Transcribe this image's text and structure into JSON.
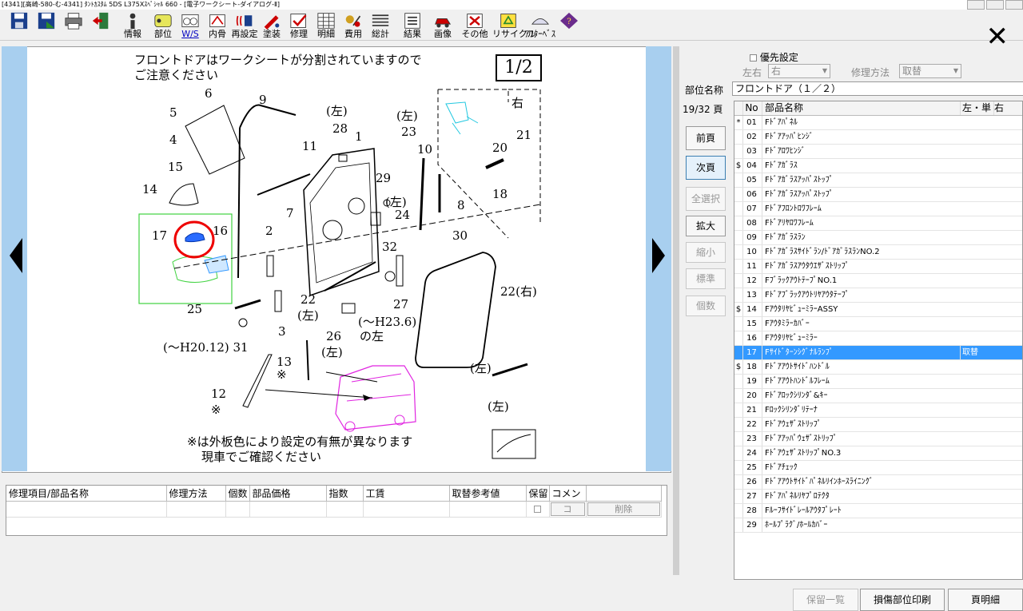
{
  "window": {
    "title": "[4341][高崎-580-む-4341] ﾀﾝﾄｶｽﾀﾑ 5DS L375Xｽﾍﾟｼｬﾙ 660 - [電子ワークシート-ダイアログ-Ⅱ]"
  },
  "toolbar": {
    "items": [
      {
        "label": "",
        "icon": "save-icon"
      },
      {
        "label": "",
        "icon": "save-as-icon"
      },
      {
        "label": "",
        "icon": "print-icon"
      },
      {
        "label": "",
        "icon": "exit-door-icon"
      },
      {
        "label": "情報",
        "icon": "info-icon"
      },
      {
        "label": "部位",
        "icon": "part-icon"
      },
      {
        "label": "W/S",
        "icon": "worksheet-icon"
      },
      {
        "label": "内骨",
        "icon": "inner-frame-icon"
      },
      {
        "label": "再設定",
        "icon": "reset-icon"
      },
      {
        "label": "塗装",
        "icon": "paint-icon"
      },
      {
        "label": "修理",
        "icon": "repair-icon"
      },
      {
        "label": "明細",
        "icon": "detail-icon"
      },
      {
        "label": "費用",
        "icon": "cost-icon"
      },
      {
        "label": "総計",
        "icon": "total-icon"
      },
      {
        "label": "結果",
        "icon": "result-icon"
      },
      {
        "label": "画像",
        "icon": "image-icon"
      },
      {
        "label": "その他",
        "icon": "other-icon"
      },
      {
        "label": "リサイクル",
        "icon": "recycle-icon"
      },
      {
        "label": "ｱﾌﾀｰﾍﾞｽ",
        "icon": "afterbase-icon"
      },
      {
        "label": "",
        "icon": "help-book-icon"
      }
    ],
    "close_glyph": "✕"
  },
  "worksheet": {
    "notice_line1": "フロントドアはワークシートが分割されていますので",
    "notice_line2": "ご注意ください",
    "page_indicator": "1/2",
    "footer_line1": "※は外板色により設定の有無が異なります",
    "footer_line2": "現車でご確認ください",
    "labels": {
      "l_left_a": "(左)",
      "l_left_b": "(左)",
      "l_right_box": "右",
      "l_left_c": "(左)",
      "l_left_d": "(左)",
      "l_left_e": "(左)",
      "l_left_f": "(左)",
      "l_left_g": "(左)",
      "l_right_22": "22(右)",
      "l_h20": "(〜H20.12) 31",
      "l_h23a": "(〜H23.6)",
      "l_h23b": "の左",
      "l_star1": "※",
      "l_star2": "※"
    }
  },
  "grid": {
    "headers": [
      "修理項目/部品名称",
      "修理方法",
      "個数",
      "部品価格",
      "指数",
      "工賃",
      "取替参考値",
      "保留",
      "コメン"
    ],
    "btn_ko": "コ",
    "btn_delete": "削除"
  },
  "panel": {
    "priority_label": "優先設定",
    "lr_label": "左右",
    "lr_value": "右",
    "method_label": "修理方法",
    "method_value": "取替",
    "part_name_label": "部位名称",
    "part_name_value": "フロントドア（１／２）",
    "page_count": "19/32 頁",
    "buttons": [
      "前頁",
      "次頁",
      "全選択",
      "拡大",
      "縮小",
      "標準",
      "個数"
    ],
    "list_headers": {
      "no": "No",
      "name": "部品名称",
      "lr": "左・単",
      "extra": "右"
    },
    "parts": [
      {
        "mark": "*",
        "no": "01",
        "name": "Fﾄﾞｱﾊﾟﾈﾙ",
        "lr": ""
      },
      {
        "mark": "",
        "no": "02",
        "name": "Fﾄﾞｱｱｯﾊﾟﾋﾝｼﾞ",
        "lr": ""
      },
      {
        "mark": "",
        "no": "03",
        "name": "Fﾄﾞｱﾛﾜﾋﾝｼﾞ",
        "lr": ""
      },
      {
        "mark": "$",
        "no": "04",
        "name": "Fﾄﾞｱｶﾞﾗｽ",
        "lr": ""
      },
      {
        "mark": "",
        "no": "05",
        "name": "Fﾄﾞｱｶﾞﾗｽｱｯﾊﾟｽﾄｯﾌﾟ",
        "lr": ""
      },
      {
        "mark": "",
        "no": "06",
        "name": "Fﾄﾞｱｶﾞﾗｽｱｯﾊﾟｽﾄｯﾌﾟ",
        "lr": ""
      },
      {
        "mark": "",
        "no": "07",
        "name": "Fﾄﾞｱﾌﾛﾝﾄﾛﾜﾌﾚｰﾑ",
        "lr": ""
      },
      {
        "mark": "",
        "no": "08",
        "name": "Fﾄﾞｱﾘﾔﾛﾜﾌﾚｰﾑ",
        "lr": ""
      },
      {
        "mark": "",
        "no": "09",
        "name": "Fﾄﾞｱｶﾞﾗｽﾗﾝ",
        "lr": ""
      },
      {
        "mark": "",
        "no": "10",
        "name": "Fﾄﾞｱｶﾞﾗｽｻｲﾄﾞﾗﾝ/ﾄﾞｱｶﾞﾗｽﾗﾝNO.2",
        "lr": ""
      },
      {
        "mark": "",
        "no": "11",
        "name": "Fﾄﾞｱｶﾞﾗｽｱｳﾀｳｴｻﾞｽﾄﾘｯﾌﾟ",
        "lr": ""
      },
      {
        "mark": "",
        "no": "12",
        "name": "FﾌﾞﾗｯｸｱｳﾄﾃｰﾌﾟNO.1",
        "lr": ""
      },
      {
        "mark": "",
        "no": "13",
        "name": "Fﾄﾞｱﾌﾞﾗｯｸｱｳﾄﾘﾔｱｳﾀﾃｰﾌﾟ",
        "lr": ""
      },
      {
        "mark": "$",
        "no": "14",
        "name": "FｱｳﾀﾘﾔﾋﾞｭｰﾐﾗｰASSY",
        "lr": ""
      },
      {
        "mark": "",
        "no": "15",
        "name": "Fｱｳﾀﾐﾗｰｶﾊﾞｰ",
        "lr": ""
      },
      {
        "mark": "",
        "no": "16",
        "name": "Fｱｳﾀﾘﾔﾋﾞｭｰﾐﾗｰ",
        "lr": ""
      },
      {
        "mark": "",
        "no": "17",
        "name": "Fｻｲﾄﾞﾀｰﾝｼｸﾞﾅﾙﾗﾝﾌﾟ",
        "lr": "取替",
        "selected": true
      },
      {
        "mark": "$",
        "no": "18",
        "name": "Fﾄﾞｱｱｳﾄｻｲﾄﾞﾊﾝﾄﾞﾙ",
        "lr": ""
      },
      {
        "mark": "",
        "no": "19",
        "name": "Fﾄﾞｱｱｳﾄﾊﾝﾄﾞﾙﾌﾚｰﾑ",
        "lr": ""
      },
      {
        "mark": "",
        "no": "20",
        "name": "Fﾄﾞｱﾛｯｸｼﾘﾝﾀﾞ&ｷｰ",
        "lr": ""
      },
      {
        "mark": "",
        "no": "21",
        "name": "Fﾛｯｸｼﾘﾝﾀﾞﾘﾃｰﾅ",
        "lr": ""
      },
      {
        "mark": "",
        "no": "22",
        "name": "Fﾄﾞｱｳｪｻﾞｽﾄﾘｯﾌﾟ",
        "lr": ""
      },
      {
        "mark": "",
        "no": "23",
        "name": "Fﾄﾞｱｱｯﾊﾟｳｪｻﾞｽﾄﾘｯﾌﾟ",
        "lr": ""
      },
      {
        "mark": "",
        "no": "24",
        "name": "FﾄﾞｱｳｪｻﾞｽﾄﾘｯﾌﾟNO.3",
        "lr": ""
      },
      {
        "mark": "",
        "no": "25",
        "name": "Fﾄﾞｱﾁｪｯｸ",
        "lr": ""
      },
      {
        "mark": "",
        "no": "26",
        "name": "Fﾄﾞｱｱｳﾄｻｲﾄﾞﾊﾟﾈﾙﾘｲﾝﾎｰｽﾗｲﾆﾝｸﾞ",
        "lr": ""
      },
      {
        "mark": "",
        "no": "27",
        "name": "Fﾄﾞｱﾊﾟﾈﾙﾘﾔﾌﾟﾛﾃｸﾀ",
        "lr": ""
      },
      {
        "mark": "",
        "no": "28",
        "name": "Fﾙｰﾌｻｲﾄﾞﾚｰﾙｱｳﾀﾌﾟﾚｰﾄ",
        "lr": ""
      },
      {
        "mark": "",
        "no": "29",
        "name": "ﾎｰﾙﾌﾟﾗｸﾞ/ﾎｰﾙｶﾊﾞｰ",
        "lr": ""
      }
    ],
    "bottom_buttons": {
      "hold_list": "保留一覧",
      "print_damage": "損傷部位印刷",
      "page_detail": "頁明細"
    }
  }
}
